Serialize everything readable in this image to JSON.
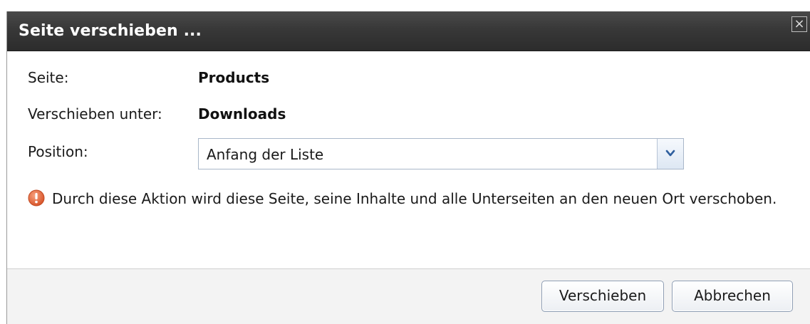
{
  "dialog": {
    "title": "Seite verschieben ...",
    "close_glyph": "×",
    "icons": {
      "close": "close-icon",
      "dropdown": "chevron-down-icon",
      "warning": "warning-icon"
    }
  },
  "form": {
    "page_label": "Seite:",
    "page_value": "Products",
    "move_under_label": "Verschieben unter:",
    "move_under_value": "Downloads",
    "position_label": "Position:",
    "position_selected": "Anfang der Liste"
  },
  "warning": {
    "text": "Durch diese Aktion wird diese Seite, seine Inhalte und alle Unterseiten an den neuen Ort verschoben.",
    "color": "#e2683a"
  },
  "buttons": {
    "move_label": "Verschieben",
    "cancel_label": "Abbrechen"
  },
  "colors": {
    "titlebar": "#383838",
    "footer": "#f3f3f3",
    "button_border": "#8f9eb4"
  }
}
